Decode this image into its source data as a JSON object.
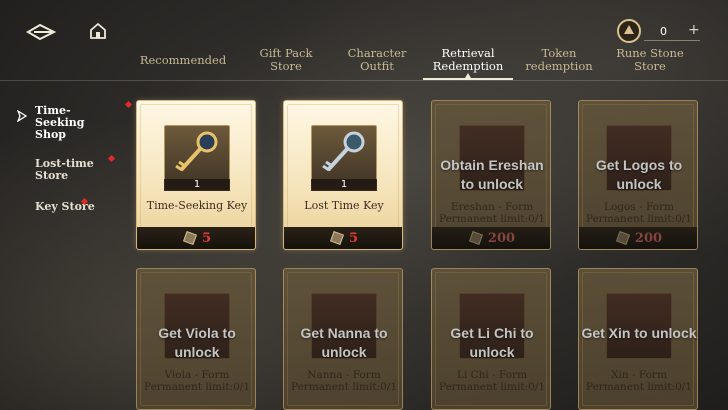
{
  "header": {
    "currency_amount": "0",
    "currency_plus": "+"
  },
  "tabs": [
    {
      "label": "Recommended"
    },
    {
      "label": "Gift Pack Store"
    },
    {
      "label": "Character Outfit"
    },
    {
      "label": "Retrieval Redemption"
    },
    {
      "label": "Token redemption"
    },
    {
      "label": "Rune Stone Store"
    }
  ],
  "sidebar": {
    "items": [
      {
        "label": "Time-Seeking Shop"
      },
      {
        "label": "Lost-time Store"
      },
      {
        "label": "Key Store"
      }
    ]
  },
  "cards": [
    {
      "name": "Time-Seeking Key",
      "qty": "1",
      "price": "5"
    },
    {
      "name": "Lost Time Key",
      "qty": "1",
      "price": "5"
    },
    {
      "lock_message": "Obtain Ereshan to unlock",
      "form": "Ereshan - Form",
      "limit": "Permanent limit:0/1",
      "price": "200"
    },
    {
      "lock_message": "Get Logos to unlock",
      "form": "Logos - Form",
      "limit": "Permanent limit:0/1",
      "price": "200"
    },
    {
      "lock_message": "Get Viola to unlock",
      "form": "Viola - Form",
      "limit": "Permanent limit:0/1"
    },
    {
      "lock_message": "Get Nanna to unlock",
      "form": "Nanna - Form",
      "limit": "Permanent limit:0/1"
    },
    {
      "lock_message": "Get Li Chi to unlock",
      "form": "Li Chi - Form",
      "limit": "Permanent limit:0/1"
    },
    {
      "lock_message": "Get Xin to unlock",
      "form": "Xin - Form",
      "limit": "Permanent limit:0/1"
    }
  ],
  "colors": {
    "price_red": "#e23b35",
    "accent_gold": "#c9b894",
    "badge_red": "#e02a2a"
  },
  "icons": {
    "back": "back-arrow-icon",
    "home": "home-icon",
    "currency": "rune-coin-icon",
    "price": "key-token-icon"
  }
}
